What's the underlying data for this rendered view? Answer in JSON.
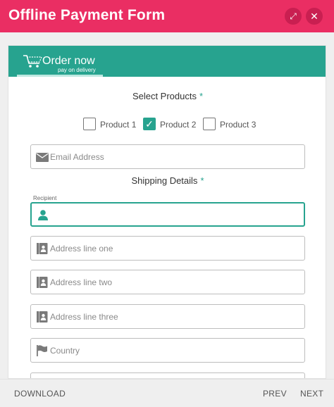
{
  "window": {
    "title": "Offline Payment Form"
  },
  "banner": {
    "heading": "Order now",
    "subheading": "pay on delivery"
  },
  "products": {
    "label": "Select Products",
    "required_mark": "*",
    "items": [
      {
        "label": "Product 1",
        "checked": false
      },
      {
        "label": "Product 2",
        "checked": true
      },
      {
        "label": "Product 3",
        "checked": false
      }
    ]
  },
  "email": {
    "placeholder": "Email Address"
  },
  "shipping": {
    "label": "Shipping Details",
    "required_mark": "*",
    "recipient_label": "Recipient",
    "recipient_value": "",
    "address1_placeholder": "Address line one",
    "address2_placeholder": "Address line two",
    "address3_placeholder": "Address line three",
    "country_placeholder": "Country"
  },
  "footer": {
    "download": "DOWNLOAD",
    "prev": "PREV",
    "next": "NEXT"
  },
  "colors": {
    "header": "#ea2e63",
    "accent": "#27a38f"
  }
}
